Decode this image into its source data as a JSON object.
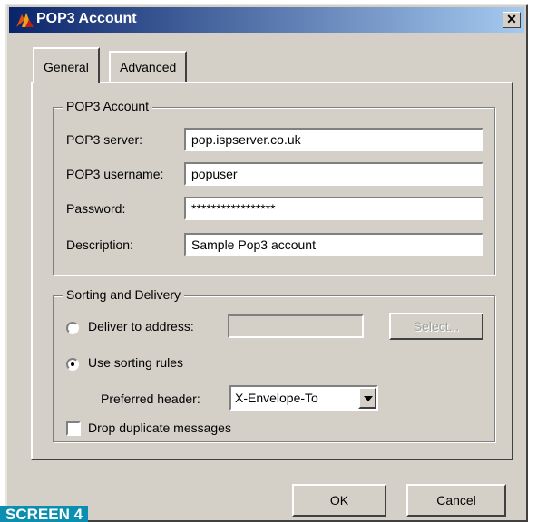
{
  "window": {
    "title": "POP3 Account"
  },
  "tabs": [
    {
      "label": "General",
      "active": true
    },
    {
      "label": "Advanced",
      "active": false
    }
  ],
  "pop3_account": {
    "group_label": "POP3 Account",
    "server_label": "POP3 server:",
    "server_value": "pop.ispserver.co.uk",
    "username_label": "POP3 username:",
    "username_value": "popuser",
    "password_label": "Password:",
    "password_value": "*****************",
    "description_label": "Description:",
    "description_value": "Sample Pop3 account"
  },
  "sorting": {
    "group_label": "Sorting and Delivery",
    "deliver_label": "Deliver to address:",
    "deliver_selected": false,
    "deliver_value": "",
    "select_button": "Select...",
    "sorting_rules_label": "Use sorting rules",
    "sorting_rules_selected": true,
    "preferred_header_label": "Preferred header:",
    "preferred_header_value": "X-Envelope-To",
    "drop_duplicates_label": "Drop duplicate messages",
    "drop_duplicates_checked": false
  },
  "buttons": {
    "ok": "OK",
    "cancel": "Cancel"
  },
  "caption": "SCREEN 4"
}
